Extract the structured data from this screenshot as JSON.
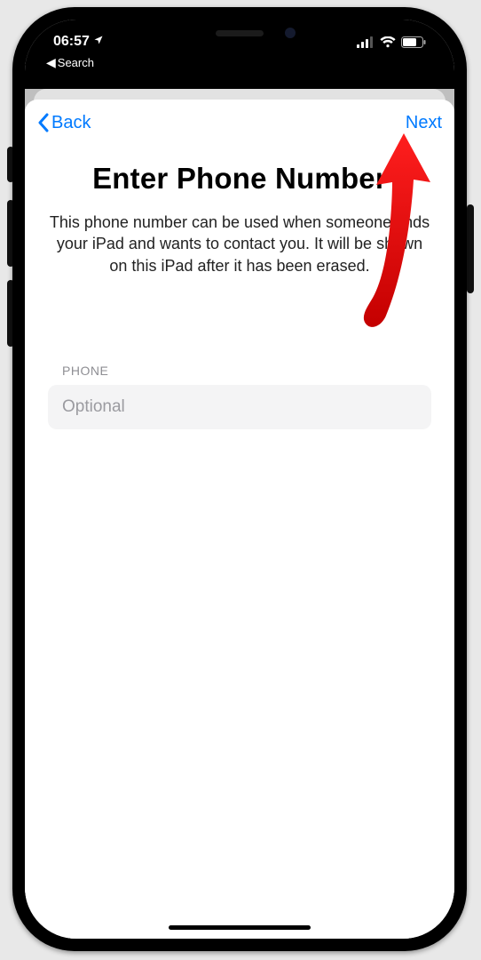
{
  "status": {
    "time": "06:57",
    "breadcrumb": "Search"
  },
  "nav": {
    "back_label": "Back",
    "next_label": "Next"
  },
  "page": {
    "title": "Enter Phone Number",
    "subtitle": "This phone number can be used when someone finds your iPad and wants to contact you. It will be shown on this iPad after it has been erased."
  },
  "field": {
    "label": "PHONE",
    "placeholder": "Optional",
    "value": ""
  }
}
